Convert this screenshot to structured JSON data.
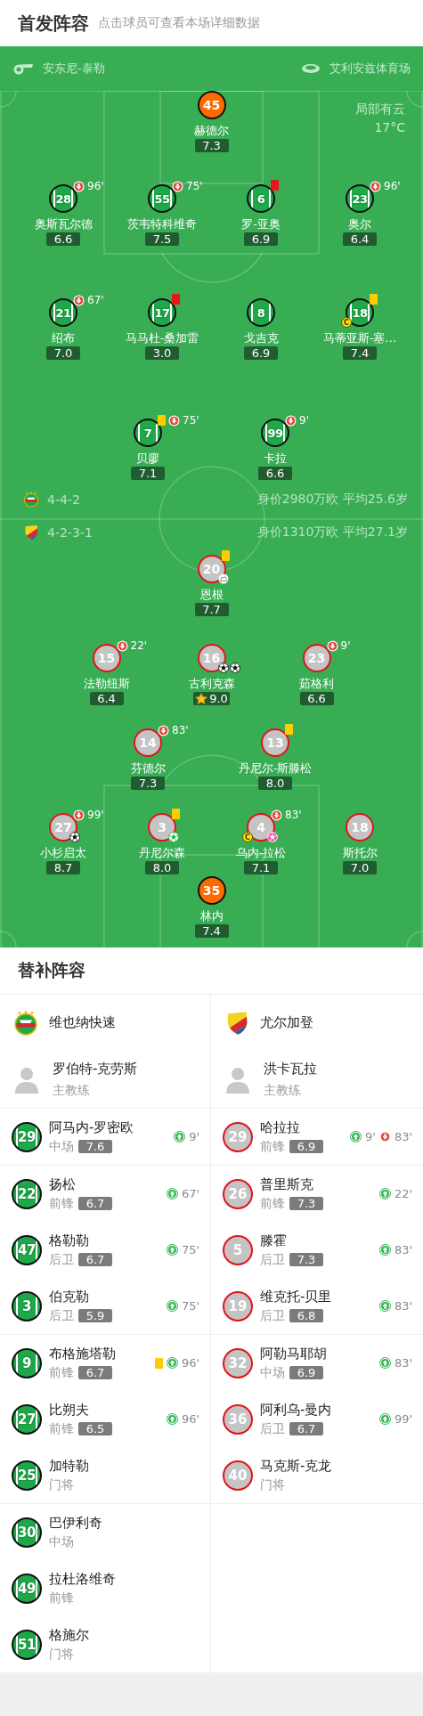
{
  "header": {
    "title": "首发阵容",
    "subtitle": "点击球员可查看本场详细数据"
  },
  "pitch": {
    "referee": "安东尼-泰勒",
    "stadium": "艾利安兹体育场",
    "weather": "局部有云",
    "temperature": "17°C",
    "home_rows": [
      [
        {
          "kind": "keeper",
          "number": "45",
          "name": "赫德尔",
          "rating": "7.3",
          "best": false
        }
      ],
      [
        {
          "kind": "outfield",
          "number": "28",
          "name": "奥斯瓦尔德",
          "rating": "6.6",
          "best": false,
          "events": [
            {
              "kind": "sub_off",
              "minute": "96'"
            }
          ]
        },
        {
          "kind": "outfield",
          "number": "55",
          "name": "茨韦特科维奇",
          "rating": "7.5",
          "best": false,
          "events": [
            {
              "kind": "sub_off",
              "minute": "75'"
            }
          ]
        },
        {
          "kind": "outfield",
          "number": "6",
          "name": "罗-亚奥",
          "rating": "6.9",
          "best": false,
          "events": [
            {
              "kind": "red"
            }
          ]
        },
        {
          "kind": "outfield",
          "number": "23",
          "name": "奥尔",
          "rating": "6.4",
          "best": false,
          "events": [
            {
              "kind": "sub_off",
              "minute": "96'"
            }
          ]
        }
      ],
      [
        {
          "kind": "outfield",
          "number": "21",
          "name": "绍布",
          "rating": "7.0",
          "best": false,
          "events": [
            {
              "kind": "sub_off",
              "minute": "67'"
            }
          ]
        },
        {
          "kind": "outfield",
          "number": "17",
          "name": "马马杜-桑加雷",
          "rating": "3.0",
          "best": false,
          "events": [
            {
              "kind": "red"
            }
          ]
        },
        {
          "kind": "outfield",
          "number": "8",
          "name": "戈吉克",
          "rating": "6.9",
          "best": false
        },
        {
          "kind": "outfield",
          "number": "18",
          "name": "马蒂亚斯-塞…",
          "rating": "7.4",
          "best": false,
          "events": [
            {
              "kind": "yellow"
            },
            {
              "kind": "captain",
              "label": "C"
            }
          ]
        }
      ],
      [
        {
          "kind": "outfield",
          "number": "7",
          "name": "贝廖",
          "rating": "7.1",
          "best": false,
          "events": [
            {
              "kind": "yellow"
            },
            {
              "kind": "sub_off",
              "minute": "75'"
            }
          ]
        },
        {
          "kind": "outfield",
          "number": "99",
          "name": "卡拉",
          "rating": "6.6",
          "best": false,
          "events": [
            {
              "kind": "sub_off",
              "minute": "9'"
            }
          ]
        }
      ]
    ],
    "formations": [
      {
        "kind": "home",
        "formation": "4-4-2",
        "info": "身价2980万欧 平均25.6岁"
      },
      {
        "kind": "away",
        "formation": "4-2-3-1",
        "info": "身价1310万欧 平均27.1岁"
      }
    ],
    "away_rows": [
      [
        {
          "kind": "outfield",
          "number": "20",
          "name": "恩根",
          "rating": "7.7",
          "best": false,
          "events": [
            {
              "kind": "yellow"
            },
            {
              "kind": "assist"
            }
          ]
        }
      ],
      [
        {
          "kind": "outfield",
          "number": "15",
          "name": "法勒纽斯",
          "rating": "6.4",
          "best": false,
          "events": [
            {
              "kind": "sub_off",
              "minute": "22'"
            }
          ]
        },
        {
          "kind": "outfield",
          "number": "16",
          "name": "古利克森",
          "rating": "9.0",
          "best": true,
          "events": [
            {
              "kind": "goal"
            },
            {
              "kind": "goal"
            }
          ]
        },
        {
          "kind": "outfield",
          "number": "23",
          "name": "茹格利",
          "rating": "6.6",
          "best": false,
          "events": [
            {
              "kind": "sub_off",
              "minute": "9'"
            }
          ]
        }
      ],
      [
        {
          "kind": "outfield",
          "number": "14",
          "name": "芬德尔",
          "rating": "7.3",
          "best": false,
          "events": [
            {
              "kind": "sub_off",
              "minute": "83'"
            }
          ]
        },
        {
          "kind": "outfield",
          "number": "13",
          "name": "丹尼尔-斯滕松",
          "rating": "8.0",
          "best": false,
          "events": [
            {
              "kind": "yellow"
            }
          ]
        }
      ],
      [
        {
          "kind": "outfield",
          "number": "27",
          "name": "小杉启太",
          "rating": "8.7",
          "best": false,
          "events": [
            {
              "kind": "sub_off",
              "minute": "99'"
            },
            {
              "kind": "goal"
            }
          ]
        },
        {
          "kind": "outfield",
          "number": "3",
          "name": "丹尼尔森",
          "rating": "8.0",
          "best": false,
          "events": [
            {
              "kind": "yellow"
            },
            {
              "kind": "penalty"
            }
          ]
        },
        {
          "kind": "outfield",
          "number": "4",
          "name": "乌内-拉松",
          "rating": "7.1",
          "best": false,
          "events": [
            {
              "kind": "sub_off",
              "minute": "83'"
            },
            {
              "kind": "captain",
              "label": "C"
            },
            {
              "kind": "own_goal"
            }
          ]
        },
        {
          "kind": "outfield",
          "number": "18",
          "name": "斯托尔",
          "rating": "7.0",
          "best": false
        }
      ],
      [
        {
          "kind": "keeper",
          "number": "35",
          "name": "林内",
          "rating": "7.4",
          "best": false
        }
      ]
    ]
  },
  "subs": {
    "title": "替补阵容",
    "teams": [
      {
        "kind": "home",
        "name": "维也纳快速",
        "coach": "罗伯特-克劳斯",
        "coach_role": "主教练"
      },
      {
        "kind": "away",
        "name": "尤尔加登",
        "coach": "洪卡瓦拉",
        "coach_role": "主教练"
      }
    ],
    "groups": [
      {
        "home": [
          {
            "number": "29",
            "name": "阿马内-罗密欧",
            "position": "中场",
            "rating": "7.6",
            "events": [
              {
                "kind": "sub_on",
                "minute": "9'"
              }
            ]
          }
        ],
        "away": [
          {
            "number": "29",
            "name": "哈拉拉",
            "position": "前锋",
            "rating": "6.9",
            "events": [
              {
                "kind": "sub_on",
                "minute": "9'"
              },
              {
                "kind": "sub_off",
                "minute": "83'"
              }
            ]
          }
        ]
      },
      {
        "home": [
          {
            "number": "22",
            "name": "扬松",
            "position": "前锋",
            "rating": "6.7",
            "events": [
              {
                "kind": "sub_on",
                "minute": "67'"
              }
            ]
          },
          {
            "number": "47",
            "name": "格勒勒",
            "position": "后卫",
            "rating": "6.7",
            "events": [
              {
                "kind": "sub_on",
                "minute": "75'"
              }
            ]
          },
          {
            "number": "3",
            "name": "伯克勒",
            "position": "后卫",
            "rating": "5.9",
            "events": [
              {
                "kind": "sub_on",
                "minute": "75'"
              }
            ]
          }
        ],
        "away": [
          {
            "number": "26",
            "name": "普里斯克",
            "position": "前锋",
            "rating": "7.3",
            "events": [
              {
                "kind": "sub_on",
                "minute": "22'"
              }
            ]
          },
          {
            "number": "5",
            "name": "滕霍",
            "position": "后卫",
            "rating": "7.3",
            "events": [
              {
                "kind": "sub_on",
                "minute": "83'"
              }
            ]
          },
          {
            "number": "19",
            "name": "维克托-贝里",
            "position": "后卫",
            "rating": "6.8",
            "events": [
              {
                "kind": "sub_on",
                "minute": "83'"
              }
            ]
          }
        ]
      },
      {
        "home": [
          {
            "number": "9",
            "name": "布格施塔勒",
            "position": "前锋",
            "rating": "6.7",
            "events": [
              {
                "kind": "yellow"
              },
              {
                "kind": "sub_on",
                "minute": "96'"
              }
            ]
          },
          {
            "number": "27",
            "name": "比朔夫",
            "position": "前锋",
            "rating": "6.5",
            "events": [
              {
                "kind": "sub_on",
                "minute": "96'"
              }
            ]
          },
          {
            "number": "25",
            "name": "加特勒",
            "position": "门将"
          }
        ],
        "away": [
          {
            "number": "32",
            "name": "阿勒马耶胡",
            "position": "中场",
            "rating": "6.9",
            "events": [
              {
                "kind": "sub_on",
                "minute": "83'"
              }
            ]
          },
          {
            "number": "36",
            "name": "阿利乌-曼内",
            "position": "后卫",
            "rating": "6.7",
            "events": [
              {
                "kind": "sub_on",
                "minute": "99'"
              }
            ]
          },
          {
            "number": "40",
            "name": "马克斯-克龙",
            "position": "门将"
          }
        ]
      },
      {
        "home": [
          {
            "number": "30",
            "name": "巴伊利奇",
            "position": "中场"
          },
          {
            "number": "49",
            "name": "拉杜洛维奇",
            "position": "前锋"
          },
          {
            "number": "51",
            "name": "格施尔",
            "position": "门将"
          }
        ]
      }
    ]
  }
}
